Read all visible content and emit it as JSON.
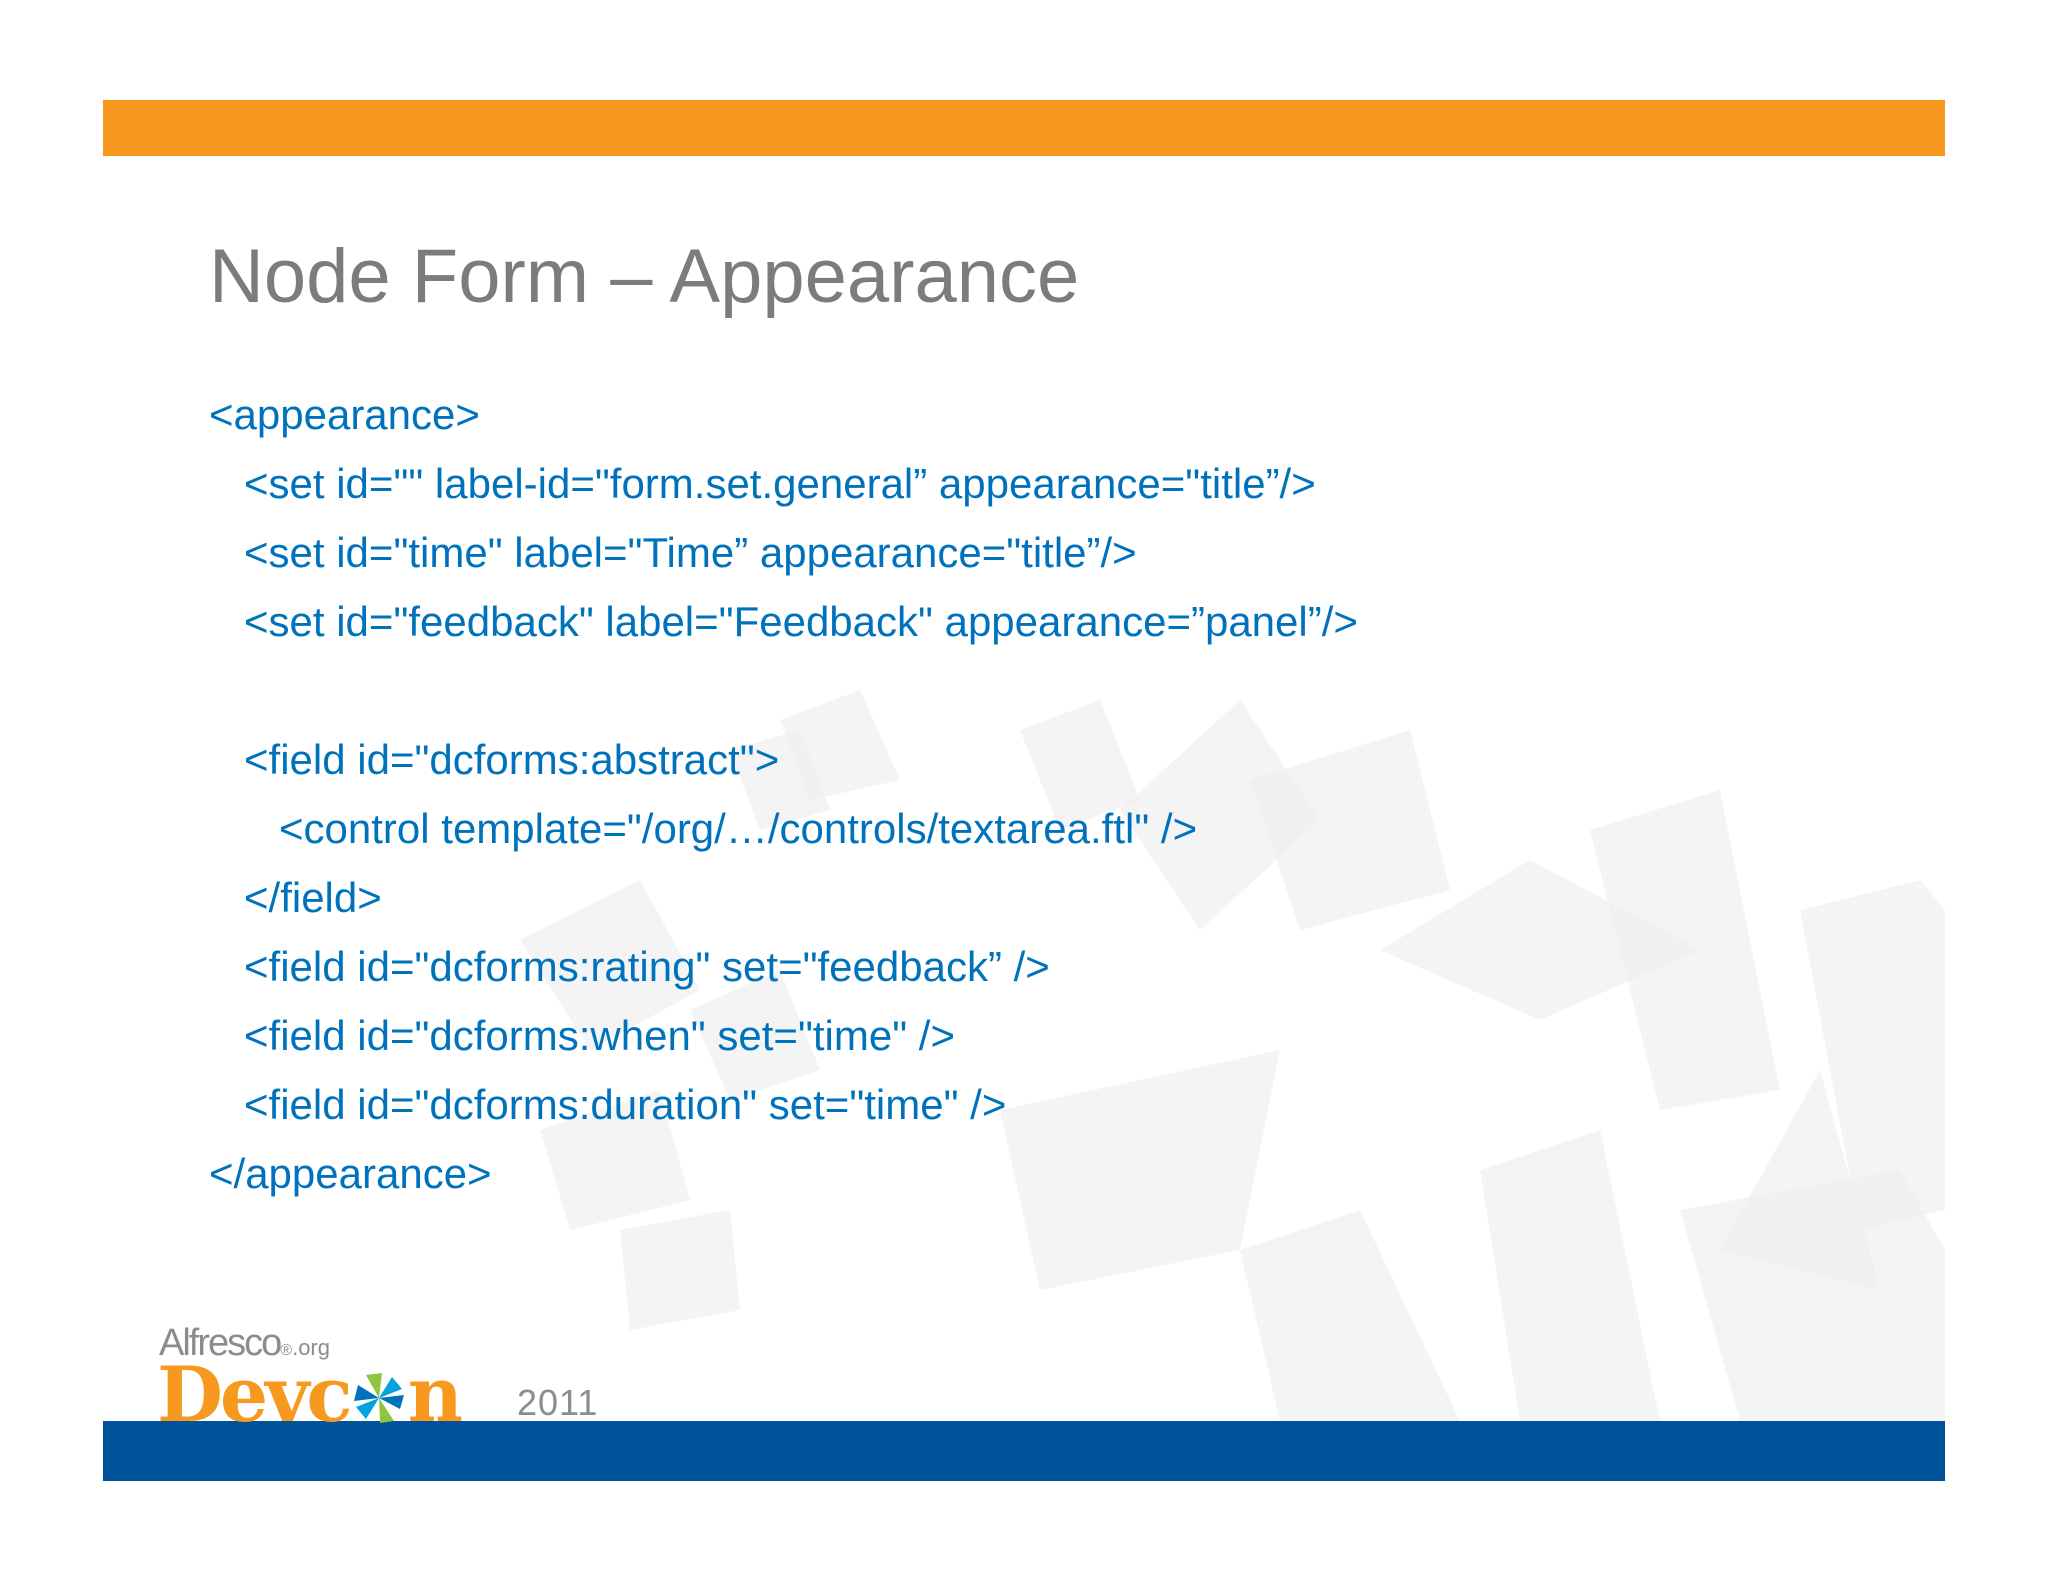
{
  "colors": {
    "top_bar": "#F7991F",
    "bottom_bar": "#00529B",
    "title": "#7C7C7C",
    "code": "#0072BC",
    "logo_devcon": "#F7991F",
    "logo_text": "#8C8C8C",
    "background_mark": "#ECECEC"
  },
  "slide": {
    "title": "Node Form – Appearance",
    "code_lines": [
      "<appearance>",
      "   <set id=\"\" label-id=\"form.set.general” appearance=\"title”/>",
      "   <set id=\"time\" label=\"Time” appearance=\"title”/>",
      "   <set id=\"feedback\" label=\"Feedback\" appearance=”panel”/>",
      "",
      "   <field id=\"dcforms:abstract\">",
      "      <control template=\"/org/…/controls/textarea.ftl\" />",
      "   </field>",
      "   <field id=\"dcforms:rating\" set=\"feedback” />",
      "   <field id=\"dcforms:when\" set=\"time\" />",
      "   <field id=\"dcforms:duration\" set=\"time\" />",
      "</appearance>"
    ]
  },
  "logo": {
    "alfresco": "Alfresco",
    "alfresco_sup": "®",
    "alfresco_org": ".org",
    "devcon_start": "Devc",
    "devcon_end": "n",
    "o_icon": "pinwheel-icon",
    "year": "2011"
  }
}
